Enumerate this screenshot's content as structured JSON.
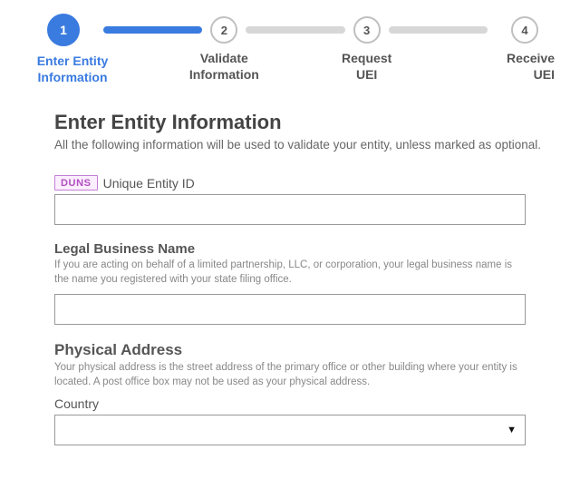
{
  "stepper": {
    "steps": [
      {
        "num": "1",
        "label": "Enter Entity Information",
        "active": true
      },
      {
        "num": "2",
        "label": "Validate Information",
        "active": false
      },
      {
        "num": "3",
        "label": "Request UEI",
        "active": false
      },
      {
        "num": "4",
        "label": "Receive UEI",
        "active": false
      }
    ]
  },
  "form": {
    "heading": "Enter Entity Information",
    "intro": "All the following information will be used to validate your entity, unless marked as optional.",
    "duns_badge": "DUNS",
    "uei_label": "Unique Entity ID",
    "uei_value": "",
    "lbn_label": "Legal Business Name",
    "lbn_help": "If you are acting on behalf of a limited partnership, LLC, or corporation, your legal business name is the name you registered with your state filing office.",
    "lbn_value": "",
    "phys_heading": "Physical Address",
    "phys_help": "Your physical address is the street address of the primary office or other building where your entity is located. A post office box may not be used as your physical address.",
    "country_label": "Country",
    "country_value": ""
  }
}
